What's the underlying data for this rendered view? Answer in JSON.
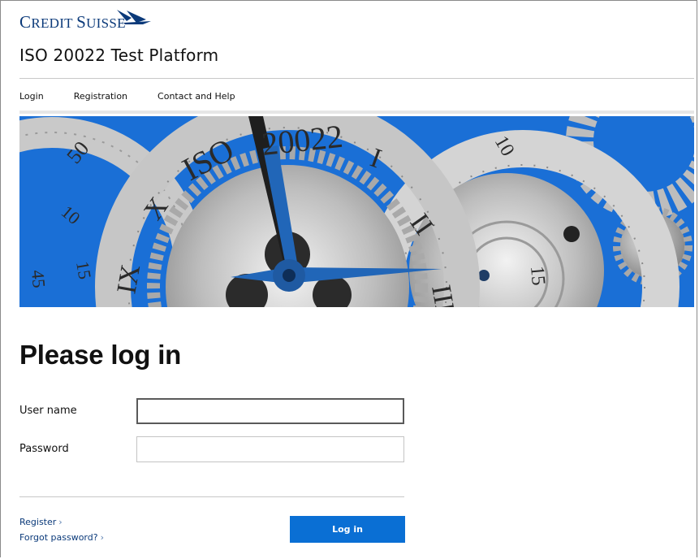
{
  "header": {
    "logo_text_first": "C",
    "logo_text_rest": "REDIT ",
    "logo_text_second": "S",
    "logo_text_second_rest": "UISSE",
    "platform_title": "ISO 20022 Test Platform"
  },
  "nav": {
    "items": [
      "Login",
      "Registration",
      "Contact and Help"
    ]
  },
  "banner": {
    "texts": [
      "ISO",
      "20022",
      "I",
      "II",
      "III",
      "IX",
      "X",
      "50",
      "10",
      "15",
      "45",
      "15",
      "10"
    ]
  },
  "form": {
    "heading": "Please log in",
    "username_label": "User name",
    "username_value": "",
    "password_label": "Password",
    "password_value": "",
    "register_link": "Register",
    "forgot_link": "Forgot password?",
    "link_chevron": "›",
    "login_button": "Log in"
  },
  "colors": {
    "brand_blue": "#0b3a7a",
    "button_blue": "#0a6fd4",
    "banner_blue": "#1a6fd6"
  }
}
